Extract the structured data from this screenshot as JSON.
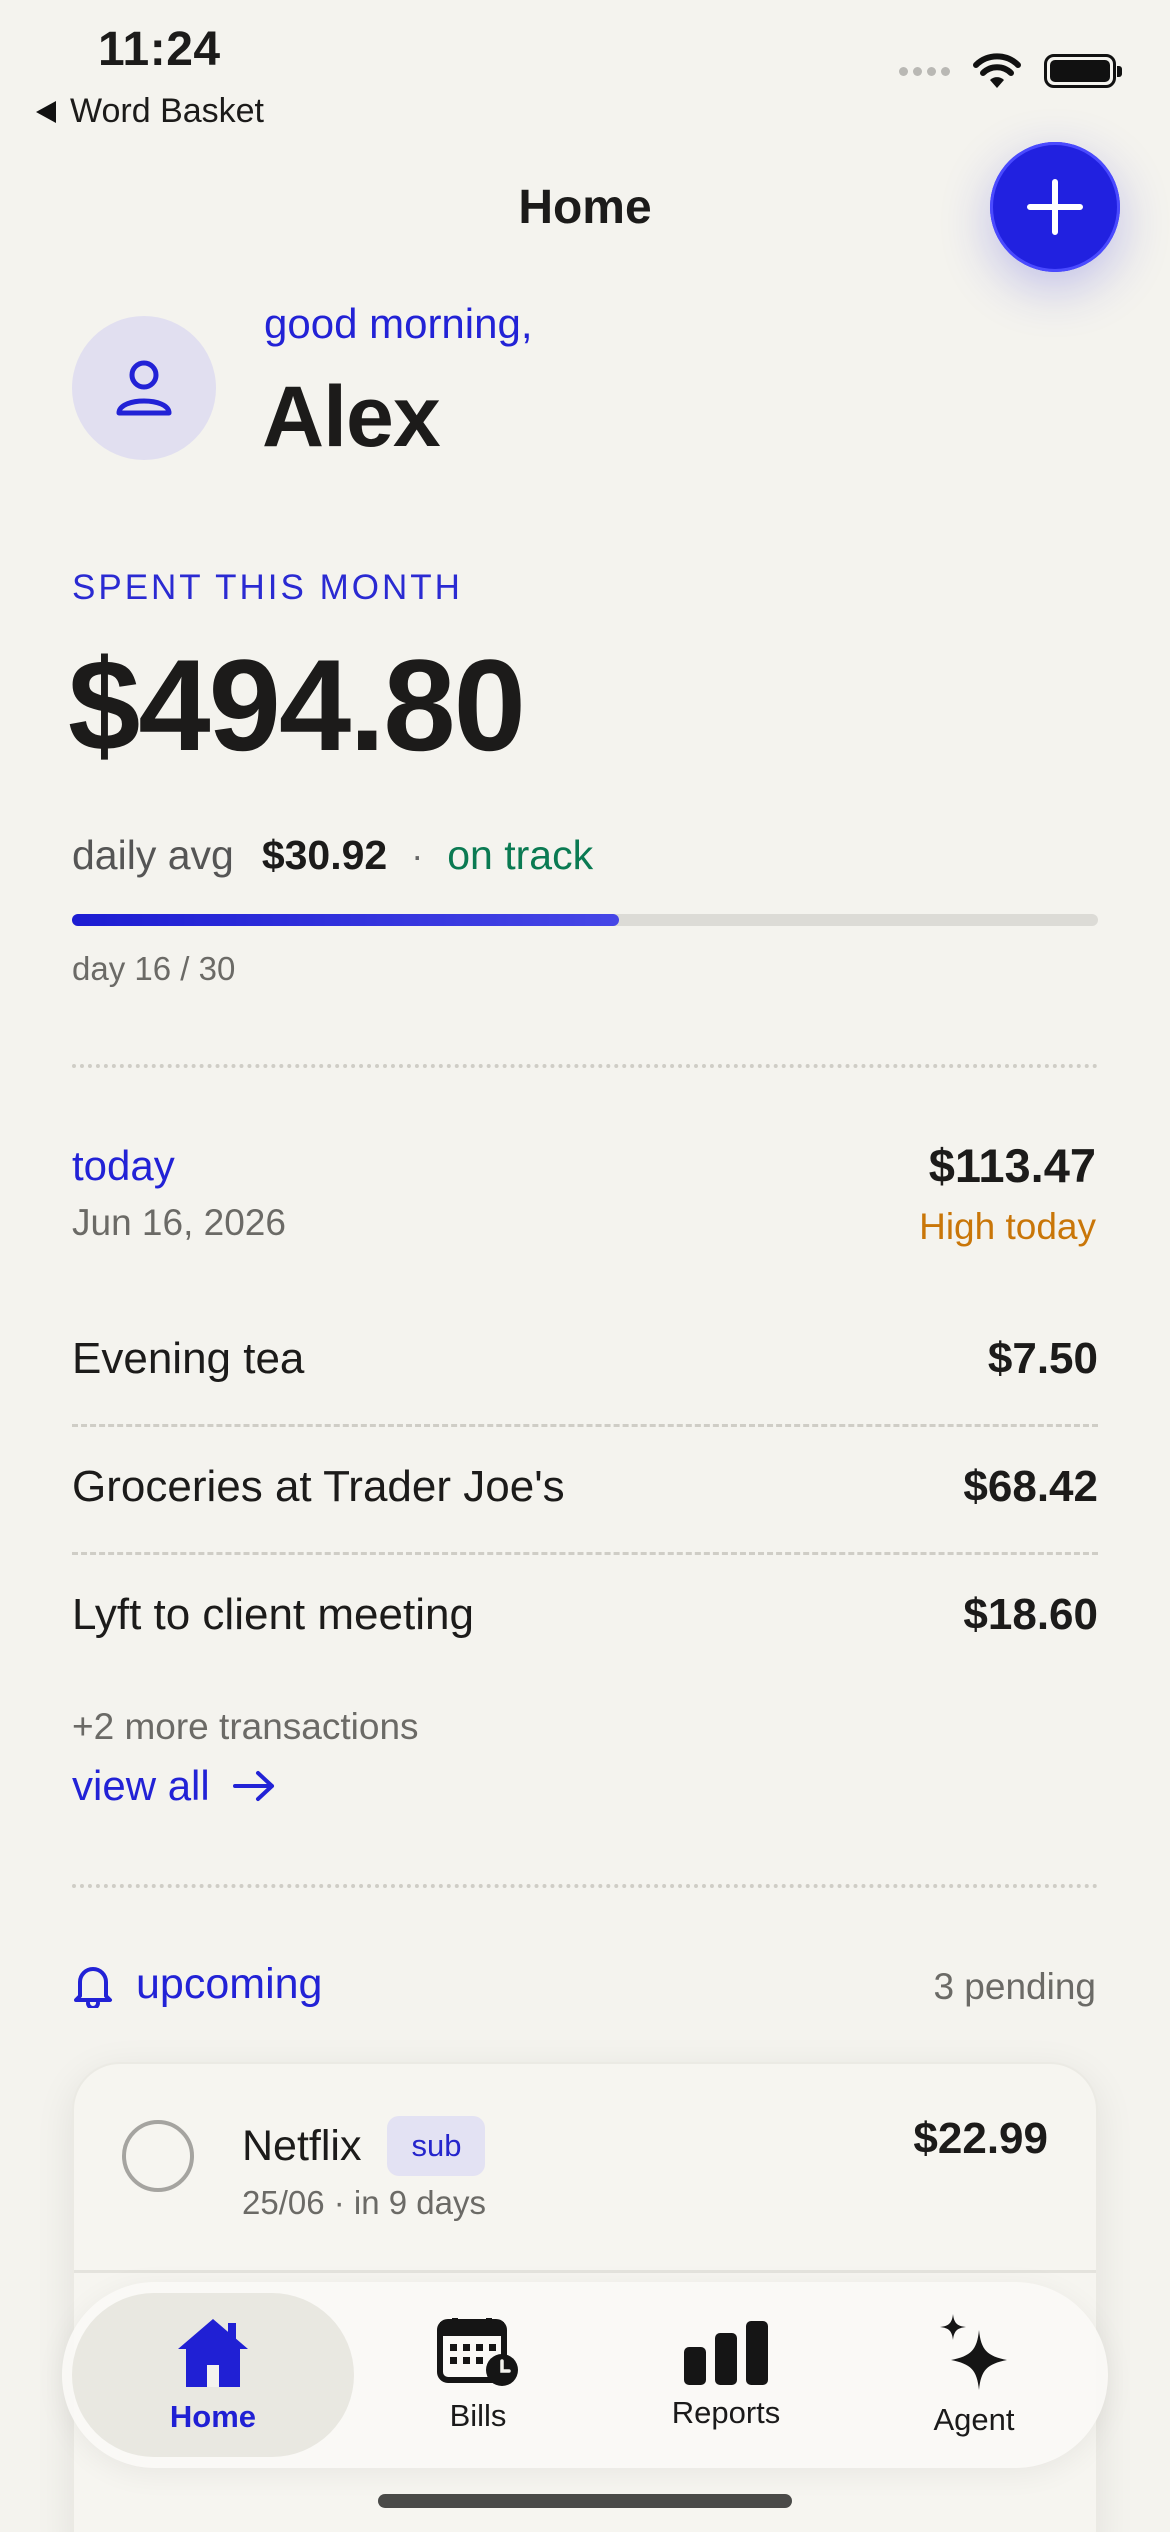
{
  "status_bar": {
    "time": "11:24",
    "back_label": "Word Basket"
  },
  "header": {
    "title": "Home",
    "add_icon": "plus-icon"
  },
  "greeting": {
    "salutation": "good morning,",
    "name": "Alex",
    "avatar_icon": "user-icon"
  },
  "spending": {
    "label": "SPENT THIS MONTH",
    "amount": "$494.80",
    "daily_avg_label": "daily avg",
    "daily_avg_value": "$30.92",
    "separator": "·",
    "status": "on track",
    "day_progress_label": "day 16 / 30",
    "progress_fraction": 0.533
  },
  "today": {
    "label": "today",
    "date": "Jun 16, 2026",
    "total": "$113.47",
    "note": "High today",
    "transactions": [
      {
        "name": "Evening tea",
        "amount": "$7.50"
      },
      {
        "name": "Groceries at Trader Joe's",
        "amount": "$68.42"
      },
      {
        "name": "Lyft to client meeting",
        "amount": "$18.60"
      }
    ],
    "more_text": "+2 more transactions",
    "view_all": "view all"
  },
  "upcoming": {
    "label": "upcoming",
    "pending": "3 pending",
    "bills": [
      {
        "name": "Netflix",
        "badge": "sub",
        "meta": "25/06 · in 9 days",
        "amount": "$22.99"
      }
    ]
  },
  "tabbar": {
    "tabs": [
      {
        "label": "Home",
        "icon": "home-icon",
        "active": true
      },
      {
        "label": "Bills",
        "icon": "calendar-clock-icon",
        "active": false
      },
      {
        "label": "Reports",
        "icon": "bar-chart-icon",
        "active": false
      },
      {
        "label": "Agent",
        "icon": "sparkles-icon",
        "active": false
      }
    ]
  },
  "colors": {
    "accent": "#2121e0",
    "positive": "#0a7a52",
    "warning": "#c97608",
    "background": "#f4f3ee"
  }
}
